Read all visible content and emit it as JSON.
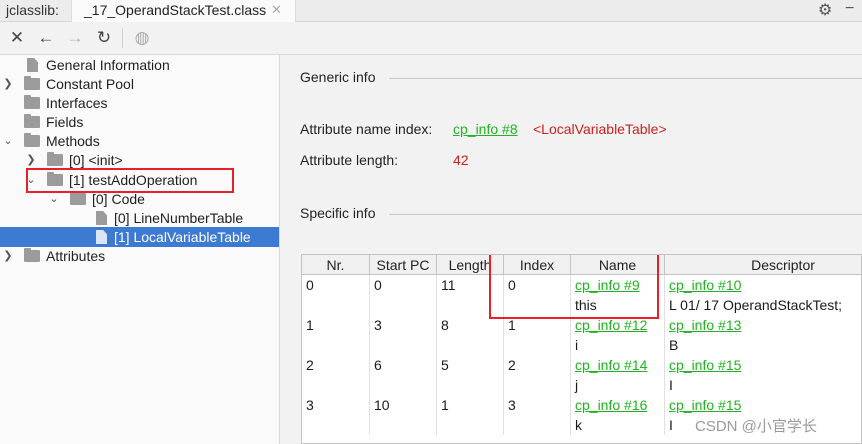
{
  "tabbar": {
    "app_label": "jclasslib:",
    "tab_title": "_17_OperandStackTest.class",
    "tab_close": "✕",
    "settings_icon": "gear-icon",
    "minimize_icon": "minus-icon"
  },
  "toolbar": {
    "close": "✕",
    "back": "←",
    "forward": "→",
    "refresh": "↻",
    "web": "◍"
  },
  "tree": {
    "general_information": "General Information",
    "constant_pool": "Constant Pool",
    "interfaces": "Interfaces",
    "fields": "Fields",
    "methods": "Methods",
    "method_init": "[0] <init>",
    "method_test": "[1] testAddOperation",
    "code": "[0] Code",
    "line_number_table": "[0] LineNumberTable",
    "local_variable_table": "[1] LocalVariableTable",
    "attributes": "Attributes"
  },
  "generic_info": {
    "title": "Generic info",
    "attr_name_label": "Attribute name index:",
    "attr_name_link": "cp_info #8",
    "attr_name_value": "<LocalVariableTable>",
    "attr_length_label": "Attribute length:",
    "attr_length_value": "42"
  },
  "specific_info": {
    "title": "Specific info",
    "columns": [
      "Nr.",
      "Start PC",
      "Length",
      "Index",
      "Name",
      "Descriptor"
    ],
    "rows": [
      {
        "nr": "0",
        "start_pc": "0",
        "length": "11",
        "index": "0",
        "name_link": "cp_info #9",
        "name_value": "this",
        "desc_link": "cp_info #10",
        "desc_value": "L 01/ 17 OperandStackTest;"
      },
      {
        "nr": "1",
        "start_pc": "3",
        "length": "8",
        "index": "1",
        "name_link": "cp_info #12",
        "name_value": "i",
        "desc_link": "cp_info #13",
        "desc_value": "B"
      },
      {
        "nr": "2",
        "start_pc": "6",
        "length": "5",
        "index": "2",
        "name_link": "cp_info #14",
        "name_value": "j",
        "desc_link": "cp_info #15",
        "desc_value": "I"
      },
      {
        "nr": "3",
        "start_pc": "10",
        "length": "1",
        "index": "3",
        "name_link": "cp_info #16",
        "name_value": "k",
        "desc_link": "cp_info #15",
        "desc_value": "I"
      }
    ]
  },
  "watermark": "CSDN @小官学长",
  "colors": {
    "link": "#21b321",
    "value_red": "#cc1f1f",
    "selection": "#3d7bd2",
    "highlight_box": "#e8202a"
  }
}
